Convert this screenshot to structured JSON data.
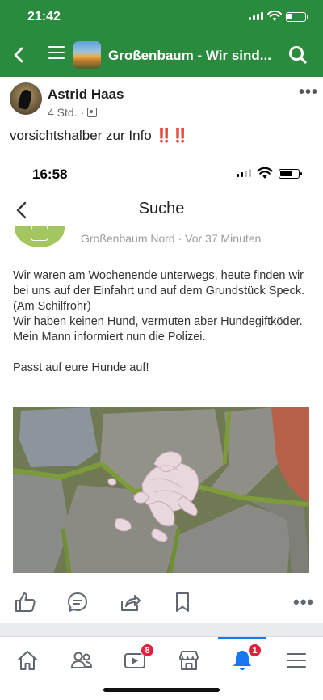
{
  "status_bar": {
    "time": "21:42"
  },
  "nav": {
    "group_title": "Großenbaum - Wir sind..."
  },
  "post": {
    "author": "Astrid Haas",
    "time_ago": "4 Std.",
    "separator": "·",
    "caption_text": "vorsichtshalber zur Info ",
    "caption_emphasis": "‼️‼️"
  },
  "embedded": {
    "status_time": "16:58",
    "title": "Suche",
    "location_line": "Großenbaum Nord · Vor 37 Minuten",
    "body_lines": [
      "Wir waren am Wochenende unterwegs, heute finden wir",
      "bei uns auf der Einfahrt und auf dem Grundstück Speck.",
      "(Am Schilfrohr)",
      "Wir haben keinen Hund, vermuten aber Hundegiftköder.",
      "Mein Mann informiert nun die Polizei."
    ],
    "body_final": "Passt auf eure Hunde auf!"
  },
  "actions": {
    "more": "•••"
  },
  "tabbar": {
    "watch_badge": "8",
    "notifications_badge": "1"
  },
  "colors": {
    "brand_green": "#2a8a3e",
    "accent_blue": "#1877f2",
    "badge_red": "#e41e3f"
  }
}
